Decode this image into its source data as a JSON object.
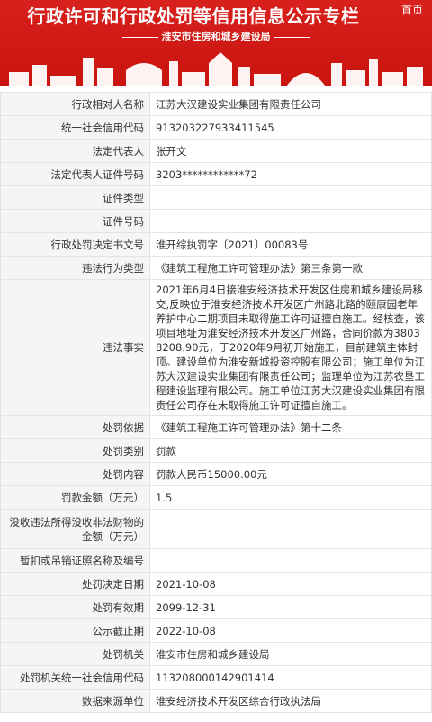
{
  "header": {
    "title": "行政许可和行政处罚等信用信息公示专栏",
    "home_link": "首页",
    "subtitle": "淮安市住房和城乡建设局"
  },
  "rows": [
    {
      "label": "行政相对人名称",
      "value": "江苏大汉建设实业集团有限责任公司"
    },
    {
      "label": "统一社会信用代码",
      "value": "913203227933411545"
    },
    {
      "label": "法定代表人",
      "value": "张开文"
    },
    {
      "label": "法定代表人证件号码",
      "value": "3203************72"
    },
    {
      "label": "证件类型",
      "value": ""
    },
    {
      "label": "证件号码",
      "value": ""
    },
    {
      "label": "行政处罚决定书文号",
      "value": "淮开综执罚字〔2021〕00083号"
    },
    {
      "label": "违法行为类型",
      "value": "《建筑工程施工许可管理办法》第三条第一款"
    },
    {
      "label": "违法事实",
      "value": "2021年6月4日接淮安经济技术开发区住房和城乡建设局移交,反映位于淮安经济技术开发区广州路北路的颐康园老年养护中心二期项目未取得施工许可证擅自施工。经核查，该项目地址为淮安经济技术开发区广州路，合同价款为38038208.90元，于2020年9月初开始施工，目前建筑主体封顶。建设单位为淮安新城投资控股有限公司；施工单位为江苏大汉建设实业集团有限责任公司；监理单位为江苏农垦工程建设监理有限公司。施工单位江苏大汉建设实业集团有限责任公司存在未取得施工许可证擅自施工。"
    },
    {
      "label": "处罚依据",
      "value": "《建筑工程施工许可管理办法》第十二条"
    },
    {
      "label": "处罚类别",
      "value": "罚款"
    },
    {
      "label": "处罚内容",
      "value": "罚款人民币15000.00元"
    },
    {
      "label": "罚款金额（万元）",
      "value": "1.5"
    },
    {
      "label": "没收违法所得没收非法财物的金额（万元）",
      "value": ""
    },
    {
      "label": "暂扣或吊销证照名称及编号",
      "value": ""
    },
    {
      "label": "处罚决定日期",
      "value": "2021-10-08"
    },
    {
      "label": "处罚有效期",
      "value": "2099-12-31"
    },
    {
      "label": "公示截止期",
      "value": "2022-10-08"
    },
    {
      "label": "处罚机关",
      "value": "淮安市住房和城乡建设局"
    },
    {
      "label": "处罚机关统一社会信用代码",
      "value": "113208000142901414"
    },
    {
      "label": "数据来源单位",
      "value": "淮安经济技术开发区综合行政执法局"
    }
  ],
  "colors": {
    "banner": "#c9140f",
    "label_bg": "#f5f5f5",
    "border": "#e3e3e3"
  }
}
